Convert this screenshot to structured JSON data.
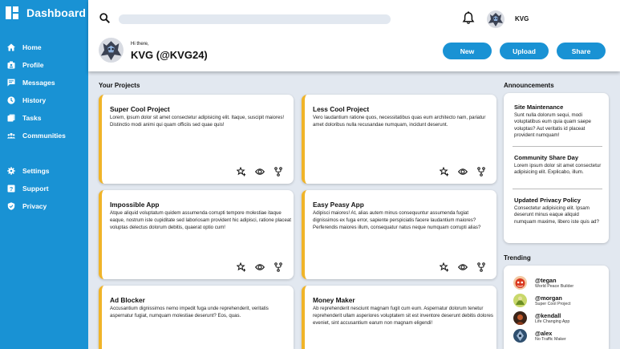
{
  "brand": {
    "title": "Dashboard"
  },
  "sidebar": {
    "primary": [
      {
        "label": "Home",
        "icon": "home-icon"
      },
      {
        "label": "Profile",
        "icon": "profile-icon"
      },
      {
        "label": "Messages",
        "icon": "messages-icon"
      },
      {
        "label": "History",
        "icon": "history-icon"
      },
      {
        "label": "Tasks",
        "icon": "tasks-icon"
      },
      {
        "label": "Communities",
        "icon": "communities-icon"
      }
    ],
    "secondary": [
      {
        "label": "Settings",
        "icon": "gear-icon"
      },
      {
        "label": "Support",
        "icon": "support-icon"
      },
      {
        "label": "Privacy",
        "icon": "shield-icon"
      }
    ]
  },
  "header": {
    "search": {
      "value": "",
      "placeholder": ""
    },
    "user": "KVG",
    "greeting": "Hi there,",
    "handle": "KVG (@KVG24)",
    "buttons": {
      "new": "New",
      "upload": "Upload",
      "share": "Share"
    }
  },
  "projects": {
    "title": "Your Projects",
    "items": [
      {
        "title": "Super Cool Project",
        "body": "Lorem, ipsum dolor sit amet consectetur adipisicing elit. Itaque, suscipit maiores! Distinctio modi animi qui quam officiis sed quae quis!"
      },
      {
        "title": "Less Cool Project",
        "body": "Vero laudantium ratione quos, necessitatibus quas eum architecto nam, pariatur amet doloribus nulla recusandae numquam, incidunt deserunt."
      },
      {
        "title": "Impossible App",
        "body": "Atque aliquid voluptatum quidem assumenda corrupti tempore molestiae itaque eaque, nostrum iste cupiditate sed laboriosam provident hic adipisci, ratione placeat voluptas delectus dolorum debitis, quaerat optio cum!"
      },
      {
        "title": "Easy Peasy App",
        "body": "Adipisci maiores! At, alias autem minus consequuntur assumenda fugiat dignissimos ex fuga error, sapiente perspiciatis facere laudantium maiores? Perferendis maiores illum, consequatur natus neque numquam corrupti alias?"
      },
      {
        "title": "Ad Blocker",
        "body": "Accusantium dignissimos nemo impedit fuga unde reprehenderit, veritatis aspernatur fugiat, numquam molestiae deserunt? Eos, quas."
      },
      {
        "title": "Money Maker",
        "body": "Ab reprehenderit nesciunt magnam fugit cum eum. Aspernatur dolorum tenetur reprehenderit ullam asperiores voluptatem sit est inventore deserunt debitis dolores eveniet, sint accusantium earum non magnam eligendi!"
      }
    ]
  },
  "announcements": {
    "title": "Announcements",
    "items": [
      {
        "title": "Site Maintenance",
        "body": "Sunt nulla dolorum sequi, modi voluptatibus eum quia quam saepe voluptas? Aut veritatis id placeat provident numquam!"
      },
      {
        "title": "Community Share Day",
        "body": "Lorem ipsum dolor sit amet consectetur adipisicing elit. Explicabo, illum."
      },
      {
        "title": "Updated Privacy Policy",
        "body": "Consectetur adipisicing elit. Ipsam deserunt minus eaque aliquid numquam maxime, libero iste quis ad?"
      }
    ]
  },
  "trending": {
    "title": "Trending",
    "items": [
      {
        "name": "@tegan",
        "sub": "World Peace Builder"
      },
      {
        "name": "@morgan",
        "sub": "Super Cool Project"
      },
      {
        "name": "@kendall",
        "sub": "Life Changing App"
      },
      {
        "name": "@alex",
        "sub": "No Traffic Maker"
      }
    ]
  },
  "colors": {
    "accent": "#1992d4",
    "card_border": "#f0b429",
    "background": "#e2e8f0"
  }
}
